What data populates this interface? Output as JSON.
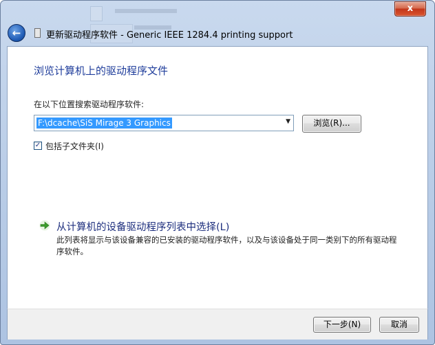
{
  "window": {
    "title": "更新驱动程序软件 - Generic IEEE 1284.4 printing support",
    "close_glyph": "x"
  },
  "nav": {
    "back_glyph": "←"
  },
  "main": {
    "heading": "浏览计算机上的驱动程序文件",
    "search_label": "在以下位置搜索驱动程序软件:",
    "path_value": "F:\\dcache\\SiS Mirage 3 Graphics",
    "dropdown_glyph": "▼",
    "browse_button": "浏览(R)...",
    "include_subfolders": {
      "label": "包括子文件夹(I)",
      "checked": true,
      "check_glyph": "✓"
    },
    "pick_list_link": "从计算机的设备驱动程序列表中选择(L)",
    "pick_list_description": "此列表将显示与该设备兼容的已安装的驱动程序软件，以及与该设备处于同一类别下的所有驱动程序软件。"
  },
  "footer": {
    "next_button": "下一步(N)",
    "cancel_button": "取消"
  },
  "colors": {
    "accent_heading": "#1f3d9b",
    "selection": "#3399ff",
    "link": "#1e2f7e",
    "green_arrow": "#3a9b2a"
  },
  "icons": [
    "back-arrow-icon",
    "wizard-icon",
    "dropdown-arrow-icon",
    "green-arrow-icon",
    "close-icon"
  ]
}
